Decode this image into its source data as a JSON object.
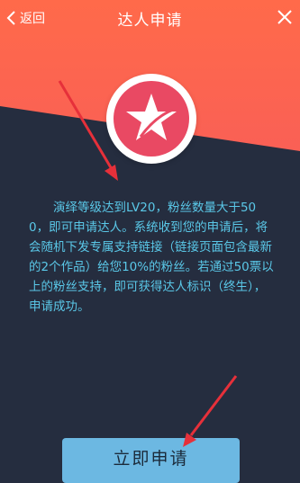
{
  "header": {
    "back_label": "返回",
    "title": "达人申请"
  },
  "main": {
    "description": "演绎等级达到LV20，粉丝数量大于500，即可申请达人。系统收到您的申请后，将会随机下发专属支持链接（链接页面包含最新的2个作品）给您10%的粉丝。若通过50票以上的粉丝支持，即可获得达人标识（终生），申请成功。",
    "apply_label": "立即申请"
  },
  "icons": {
    "back": "chevron-left-icon",
    "close": "close-icon",
    "badge": "star-badge-icon"
  },
  "colors": {
    "header_gradient_top": "#ff6a4a",
    "header_gradient_bottom": "#ee4d6a",
    "panel": "#252d3f",
    "star_circle": "#e94963",
    "text_accent": "#5ac8e8",
    "button": "#6cb8e2",
    "annotation_arrow": "#e6303a"
  }
}
